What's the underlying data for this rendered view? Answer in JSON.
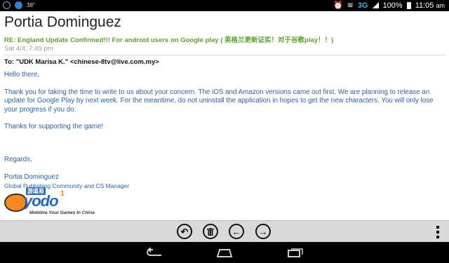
{
  "status_bar": {
    "temperature": "38°",
    "network": "3G",
    "battery": "100%",
    "time": "11:05",
    "time_suffix": "am"
  },
  "email": {
    "sender": "Portia Dominguez",
    "subject": "RE: England Update Confirmed!!! For android users on Google play ( 英格兰更新证实！对于谷歌play！！)",
    "date": "Sat 4/4, 7:49 pm",
    "to": "To: \"UDK Marisa K.\" <chinese-8tv@live.com.my>",
    "greeting": "Hello there,",
    "paragraph1": "Thank you for taking the time to write to us about your concern. The iOS and Amazon versions came out first. We are planning to release an update for Google Play by next week. For the meantime, do not uninstall the application in hopes to get the new characters. You will only lose your progress if you do.",
    "paragraph2": "Thanks for supporting the game!",
    "closing": "Regards,",
    "signature_name": "Portia Dominguez",
    "signature_title": "Global Publishing Community and CS Manager"
  },
  "logo": {
    "chinese": "游道易",
    "word": "yodo",
    "badge": "1",
    "tagline": "Mobilize Your Games In China"
  },
  "colors": {
    "subject": "#5da32b",
    "body": "#2a5ea8",
    "network": "#33b5e5"
  }
}
